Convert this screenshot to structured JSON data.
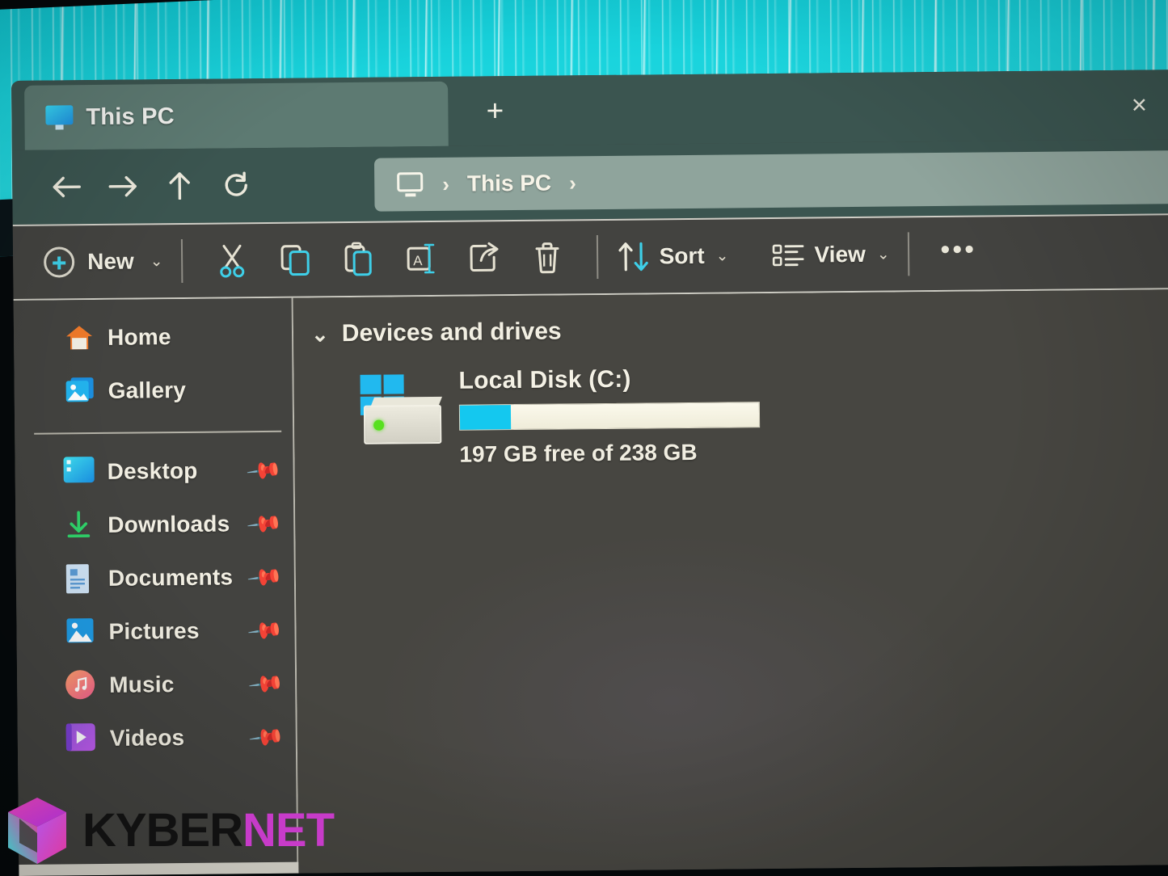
{
  "window": {
    "tab": {
      "title": "This PC",
      "icon": "this-pc-icon",
      "close_label": "×"
    },
    "new_tab_label": "+"
  },
  "nav": {
    "back": "←",
    "forward": "→",
    "up": "↑",
    "refresh": "⟳",
    "breadcrumb": {
      "root_icon": "this-pc-icon",
      "sep1": "›",
      "path": "This PC",
      "sep2": "›"
    }
  },
  "toolbar": {
    "new_label": "New",
    "new_chevron": "⌄",
    "cut_label": "Cut",
    "copy_label": "Copy",
    "paste_label": "Paste",
    "rename_label": "Rename",
    "share_label": "Share",
    "delete_label": "Delete",
    "sort_label": "Sort",
    "sort_chevron": "⌄",
    "view_label": "View",
    "view_chevron": "⌄",
    "more_label": "•••"
  },
  "sidebar": {
    "top_items": [
      {
        "label": "Home",
        "icon": "home-icon"
      },
      {
        "label": "Gallery",
        "icon": "gallery-icon"
      }
    ],
    "quick_access": [
      {
        "label": "Desktop",
        "icon": "desktop-icon",
        "pinned": "📌"
      },
      {
        "label": "Downloads",
        "icon": "downloads-icon",
        "pinned": "📌"
      },
      {
        "label": "Documents",
        "icon": "documents-icon",
        "pinned": "📌"
      },
      {
        "label": "Pictures",
        "icon": "pictures-icon",
        "pinned": "📌"
      },
      {
        "label": "Music",
        "icon": "music-icon",
        "pinned": "📌"
      },
      {
        "label": "Videos",
        "icon": "videos-icon",
        "pinned": "📌"
      }
    ]
  },
  "content": {
    "group": {
      "chevron": "⌄",
      "title": "Devices and drives"
    },
    "drives": [
      {
        "name": "Local Disk (C:)",
        "capacity_text": "197 GB free of 238 GB",
        "free_gb": 197,
        "total_gb": 238,
        "used_percent": 17,
        "fill_color": "#14c8ef",
        "icon": "local-disk-icon"
      }
    ]
  },
  "watermark": {
    "part1": "KYBER",
    "part2": "NET",
    "accent_color": "#c73bc9"
  },
  "colors": {
    "titlebar": "#3b5550",
    "active_tab": "#5d7a72",
    "address_bar": "#8fa49c",
    "toolbar": "#434340",
    "content": "#474641",
    "wallpaper_accent": "#1ad4dd"
  }
}
